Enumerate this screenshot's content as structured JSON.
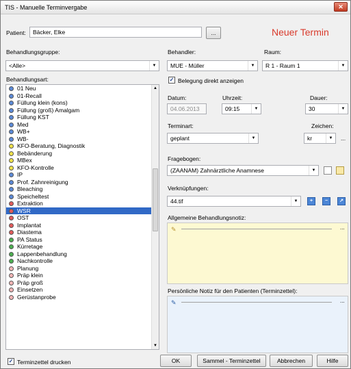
{
  "window": {
    "title": "TIS - Manuelle Terminvergabe",
    "close": "✕"
  },
  "header": {
    "patient_label": "Patient:",
    "patient_value": "Bäcker, Elke",
    "browse_label": "...",
    "new_term": "Neuer Termin"
  },
  "behandlungsgruppe": {
    "label": "Behandlungsgruppe:",
    "value": "<Alle>"
  },
  "behandlungsart": {
    "label": "Behandlungsart:",
    "items": [
      {
        "label": "01 Neu",
        "color": "#5b8ad8"
      },
      {
        "label": "01-Recall",
        "color": "#5b8ad8"
      },
      {
        "label": "Füllung klein (kons)",
        "color": "#5b8ad8"
      },
      {
        "label": "Füllung (groß) Amalgam",
        "color": "#5b8ad8"
      },
      {
        "label": "Füllung KST",
        "color": "#5b8ad8"
      },
      {
        "label": "Med",
        "color": "#5b8ad8"
      },
      {
        "label": "WB+",
        "color": "#5b8ad8"
      },
      {
        "label": "WB-",
        "color": "#5b8ad8"
      },
      {
        "label": "KFO-Beratung, Diagnostik",
        "color": "#f2e34a"
      },
      {
        "label": "Bebänderung",
        "color": "#f2e34a"
      },
      {
        "label": "MBex",
        "color": "#f2e34a"
      },
      {
        "label": "KFO-Kontrolle",
        "color": "#f2e34a"
      },
      {
        "label": "IP",
        "color": "#5b8ad8"
      },
      {
        "label": "Prof. Zahnreinigung",
        "color": "#5b8ad8"
      },
      {
        "label": "Bleaching",
        "color": "#5b8ad8"
      },
      {
        "label": "Speicheltest",
        "color": "#5b8ad8"
      },
      {
        "label": "Extraktion",
        "color": "#e25b5b"
      },
      {
        "label": "WSR",
        "color": "#e25b5b",
        "selected": true
      },
      {
        "label": "OST",
        "color": "#e25b5b"
      },
      {
        "label": "Implantat",
        "color": "#e25b5b"
      },
      {
        "label": "Diastema",
        "color": "#e25b5b"
      },
      {
        "label": "PA Status",
        "color": "#4caf50"
      },
      {
        "label": "Kürretage",
        "color": "#4caf50"
      },
      {
        "label": "Lappenbehandlung",
        "color": "#4caf50"
      },
      {
        "label": "Nachkontrolle",
        "color": "#4caf50"
      },
      {
        "label": "Planung",
        "color": "#f4b6b6"
      },
      {
        "label": "Präp klein",
        "color": "#f4b6b6"
      },
      {
        "label": "Präp groß",
        "color": "#f4b6b6"
      },
      {
        "label": "Einsetzen",
        "color": "#f4b6b6"
      },
      {
        "label": "Gerüstanprobe",
        "color": "#f4b6b6"
      }
    ]
  },
  "behandler": {
    "label": "Behandler:",
    "value": "MUE - Müller"
  },
  "raum": {
    "label": "Raum:",
    "value": "R 1 - Raum 1"
  },
  "belegung": {
    "label": "Belegung direkt anzeigen",
    "checked": "✓"
  },
  "datum": {
    "label": "Datum:",
    "value": "04.06.2013"
  },
  "uhrzeit": {
    "label": "Uhrzeit:",
    "value": "09:15"
  },
  "dauer": {
    "label": "Dauer:",
    "value": "30"
  },
  "terminart": {
    "label": "Terminart:",
    "value": "geplant"
  },
  "zeichen": {
    "label": "Zeichen:",
    "value": "kr",
    "more": "..."
  },
  "fragebogen": {
    "label": "Fragebogen:",
    "value": "(ZAANAM) Zahnärztliche Anamnese"
  },
  "verknuepfungen": {
    "label": "Verknüpfungen:",
    "value": "44.tif"
  },
  "notiz": {
    "label": "Allgemeine Behandlungsnotiz:",
    "more": "..."
  },
  "pers_notiz": {
    "label": "Persönliche Notiz für den Patienten (Terminzettel):",
    "more": "..."
  },
  "footer": {
    "print_label": "Terminzettel drucken",
    "print_checked": "✓",
    "ok": "OK",
    "sammel": "Sammel - Terminzettel",
    "abbrechen": "Abbrechen",
    "hilfe": "Hilfe"
  }
}
